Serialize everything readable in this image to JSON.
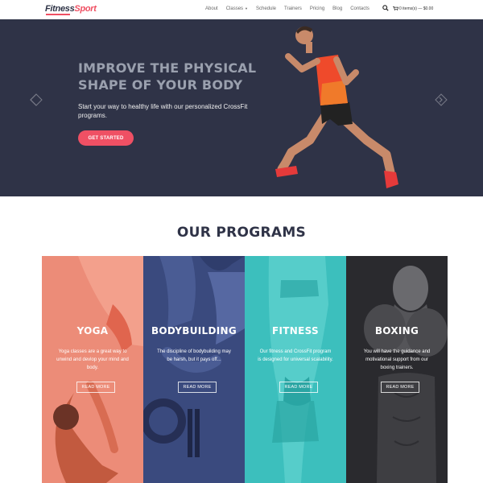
{
  "brand": {
    "name_part1": "Fitness",
    "name_part2": "Sport",
    "accent": "#ef4f62"
  },
  "nav": {
    "items": [
      "About",
      "Classes",
      "Schedule",
      "Trainers",
      "Pricing",
      "Blog",
      "Contacts"
    ],
    "cart_label": "0 items(s) — $0.00"
  },
  "hero": {
    "title": "Improve the physical shape of your body",
    "subtitle": "Start your way to healthy life with our personalized CrossFit programs.",
    "cta": "GET STARTED",
    "bg": "#2f3347"
  },
  "programs": {
    "heading": "OUR PROGRAMS",
    "cards": [
      {
        "title": "Yoga",
        "desc": "Yoga classes are a great way to unwind and devlop your mind and body.",
        "button": "READ MORE",
        "color": "#ef8f7e"
      },
      {
        "title": "Bodybuilding",
        "desc": "The discipline of bodybuilding may be harsh, but it pays off...",
        "button": "READ MORE",
        "color": "#3a4a7e"
      },
      {
        "title": "Fitness",
        "desc": "Our fitness and CrossFit program is designed for universal scalability.",
        "button": "READ MORE",
        "color": "#3cbfbd"
      },
      {
        "title": "Boxing",
        "desc": "You will have the guidance and motivational support from our boxing trainers.",
        "button": "READ MORE",
        "color": "#2a2a2e"
      }
    ]
  }
}
